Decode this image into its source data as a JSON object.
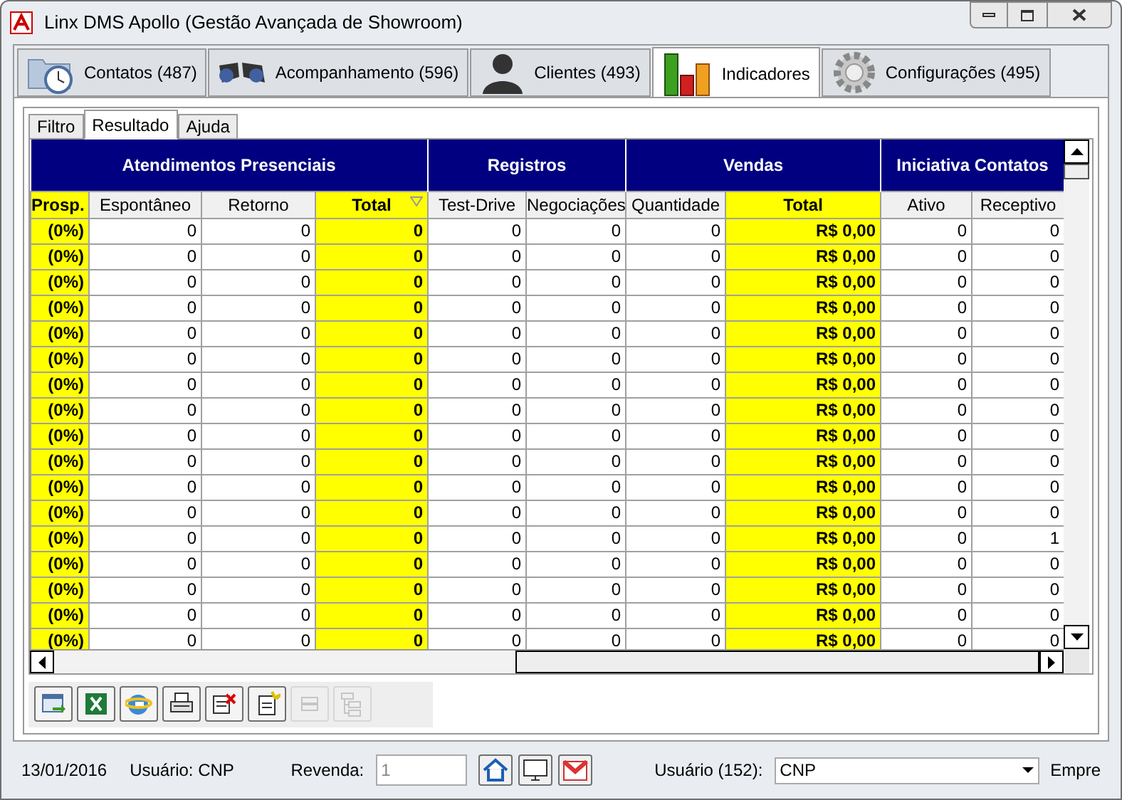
{
  "window": {
    "title": "Linx DMS Apollo (Gestão Avançada de Showroom)"
  },
  "tabs": [
    {
      "label": "Contatos (487)",
      "selected": false
    },
    {
      "label": "Acompanhamento (596)",
      "selected": false
    },
    {
      "label": "Clientes (493)",
      "selected": false
    },
    {
      "label": "Indicadores",
      "selected": true
    },
    {
      "label": "Configurações (495)",
      "selected": false
    }
  ],
  "subtabs": [
    {
      "label": "Filtro",
      "selected": false
    },
    {
      "label": "Resultado",
      "selected": true
    },
    {
      "label": "Ajuda",
      "selected": false
    }
  ],
  "table": {
    "groups": [
      "Atendimentos Presenciais",
      "Registros",
      "Vendas",
      "Iniciativa Contatos"
    ],
    "columns": [
      {
        "label": "Prosp.",
        "highlight": true,
        "sorted": false
      },
      {
        "label": "Espontâneo",
        "highlight": false,
        "sorted": false
      },
      {
        "label": "Retorno",
        "highlight": false,
        "sorted": false
      },
      {
        "label": "Total",
        "highlight": true,
        "sorted": true
      },
      {
        "label": "Test-Drive",
        "highlight": false,
        "sorted": false
      },
      {
        "label": "Negociações",
        "highlight": false,
        "sorted": false
      },
      {
        "label": "Quantidade",
        "highlight": false,
        "sorted": false
      },
      {
        "label": "Total",
        "highlight": true,
        "sorted": false
      },
      {
        "label": "Ativo",
        "highlight": false,
        "sorted": false
      },
      {
        "label": "Receptivo",
        "highlight": false,
        "sorted": false
      }
    ],
    "rows": [
      [
        "(0%)",
        "0",
        "0",
        "0",
        "0",
        "0",
        "0",
        "R$ 0,00",
        "0",
        "0"
      ],
      [
        "(0%)",
        "0",
        "0",
        "0",
        "0",
        "0",
        "0",
        "R$ 0,00",
        "0",
        "0"
      ],
      [
        "(0%)",
        "0",
        "0",
        "0",
        "0",
        "0",
        "0",
        "R$ 0,00",
        "0",
        "0"
      ],
      [
        "(0%)",
        "0",
        "0",
        "0",
        "0",
        "0",
        "0",
        "R$ 0,00",
        "0",
        "0"
      ],
      [
        "(0%)",
        "0",
        "0",
        "0",
        "0",
        "0",
        "0",
        "R$ 0,00",
        "0",
        "0"
      ],
      [
        "(0%)",
        "0",
        "0",
        "0",
        "0",
        "0",
        "0",
        "R$ 0,00",
        "0",
        "0"
      ],
      [
        "(0%)",
        "0",
        "0",
        "0",
        "0",
        "0",
        "0",
        "R$ 0,00",
        "0",
        "0"
      ],
      [
        "(0%)",
        "0",
        "0",
        "0",
        "0",
        "0",
        "0",
        "R$ 0,00",
        "0",
        "0"
      ],
      [
        "(0%)",
        "0",
        "0",
        "0",
        "0",
        "0",
        "0",
        "R$ 0,00",
        "0",
        "0"
      ],
      [
        "(0%)",
        "0",
        "0",
        "0",
        "0",
        "0",
        "0",
        "R$ 0,00",
        "0",
        "0"
      ],
      [
        "(0%)",
        "0",
        "0",
        "0",
        "0",
        "0",
        "0",
        "R$ 0,00",
        "0",
        "0"
      ],
      [
        "(0%)",
        "0",
        "0",
        "0",
        "0",
        "0",
        "0",
        "R$ 0,00",
        "0",
        "0"
      ],
      [
        "(0%)",
        "0",
        "0",
        "0",
        "0",
        "0",
        "0",
        "R$ 0,00",
        "0",
        "1"
      ],
      [
        "(0%)",
        "0",
        "0",
        "0",
        "0",
        "0",
        "0",
        "R$ 0,00",
        "0",
        "0"
      ],
      [
        "(0%)",
        "0",
        "0",
        "0",
        "0",
        "0",
        "0",
        "R$ 0,00",
        "0",
        "0"
      ],
      [
        "(0%)",
        "0",
        "0",
        "0",
        "0",
        "0",
        "0",
        "R$ 0,00",
        "0",
        "0"
      ],
      [
        "(0%)",
        "0",
        "0",
        "0",
        "0",
        "0",
        "0",
        "R$ 0,00",
        "0",
        "0"
      ]
    ]
  },
  "toolbar": [
    {
      "disabled": false
    },
    {
      "disabled": false
    },
    {
      "disabled": false
    },
    {
      "disabled": false
    },
    {
      "disabled": false
    },
    {
      "disabled": false
    },
    {
      "disabled": true
    },
    {
      "disabled": true
    }
  ],
  "status_bar": {
    "date": "13/01/2016",
    "user": "Usuário: CNP",
    "revenda_label": "Revenda:",
    "revenda": {
      "value": "1",
      "disabled": true
    },
    "user_label": "Usuário (152):",
    "user_select": "CNP",
    "trailing": "Empre"
  }
}
